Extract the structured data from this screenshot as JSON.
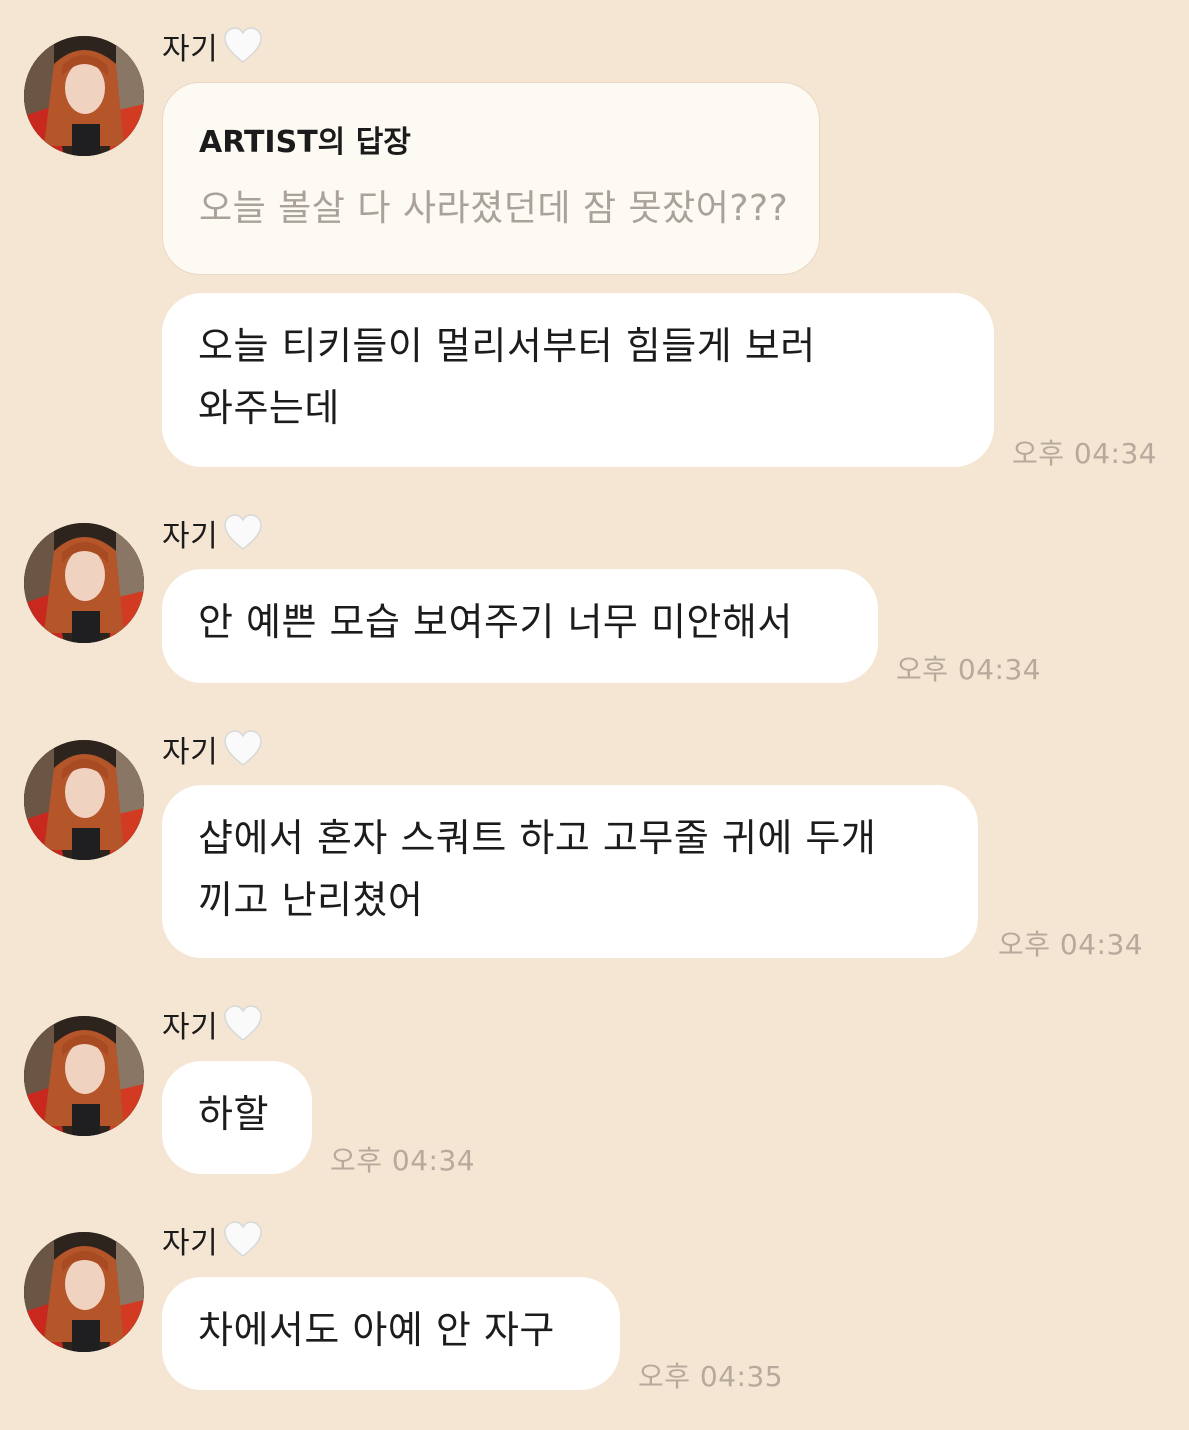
{
  "colors": {
    "background": "#f5e6d3",
    "bubble": "#ffffff",
    "reply_card": "#fdf9f3",
    "timestamp": "#b5aa9c",
    "quote_text": "#a9a29a"
  },
  "messages": [
    {
      "sender": "자기",
      "sender_icon": "white-heart-icon",
      "reply": {
        "title": "ARTIST의 답장",
        "quote": "오늘 볼살 다 사라졌던데 잠 못잤어???"
      },
      "text": "오늘 티키들이 멀리서부터 힘들게 보러 와주는데",
      "time": "오후 04:34"
    },
    {
      "sender": "자기",
      "sender_icon": "white-heart-icon",
      "text": "안 예쁜 모습 보여주기 너무 미안해서",
      "time": "오후 04:34"
    },
    {
      "sender": "자기",
      "sender_icon": "white-heart-icon",
      "text": "샵에서 혼자 스쿼트 하고 고무줄 귀에 두개 끼고 난리쳤어",
      "time": "오후 04:34"
    },
    {
      "sender": "자기",
      "sender_icon": "white-heart-icon",
      "text": "하할",
      "time": "오후 04:34"
    },
    {
      "sender": "자기",
      "sender_icon": "white-heart-icon",
      "text": "차에서도 아예 안 자구",
      "time": "오후 04:35"
    }
  ]
}
